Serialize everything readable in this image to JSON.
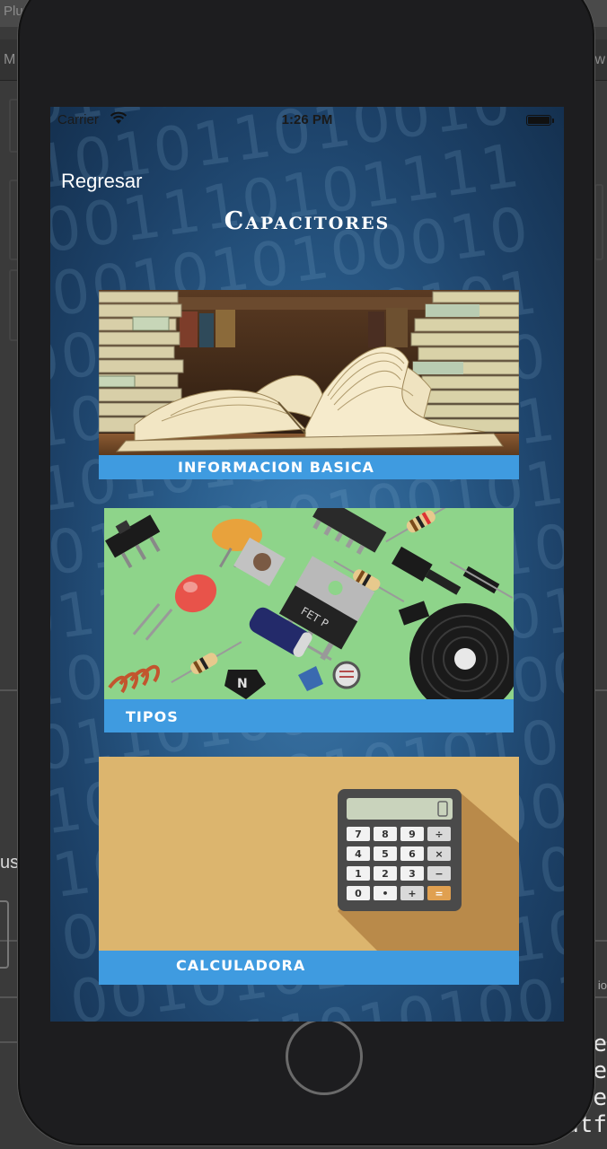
{
  "background_window": {
    "title_fragment": "Plus",
    "toolbar_left_fragment": "M",
    "toolbar_right_fragment": "ew",
    "inspector_label_fragment": "us:",
    "inspector_right_fragment": "io",
    "code_fragment": "e\ne\ne\natf"
  },
  "status_bar": {
    "carrier": "Carrier",
    "time": "1:26 PM"
  },
  "navigation": {
    "back_label": "Regresar",
    "title": "Capacitores"
  },
  "cards": [
    {
      "label": "INFORMACION BASICA",
      "image": "open-books-photo"
    },
    {
      "label": "TIPOS",
      "image": "electronic-components-illustration"
    },
    {
      "label": "CALCULADORA",
      "image": "calculator-illustration"
    }
  ],
  "colors": {
    "card_label_bg": "#3f9be0",
    "screen_bg": "#2b5f8e",
    "calculator_bg": "#dcb56e"
  }
}
